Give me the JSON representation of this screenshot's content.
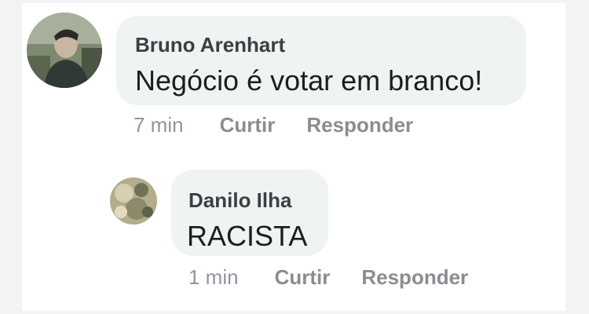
{
  "comments": [
    {
      "author": "Bruno Arenhart",
      "text": "Negócio é votar em branco!",
      "time": "7 min",
      "like_label": "Curtir",
      "reply_label": "Responder"
    }
  ],
  "reply": {
    "author": "Danilo Ilha",
    "text": "RACISTA",
    "time": "1 min",
    "like_label": "Curtir",
    "reply_label": "Responder"
  }
}
